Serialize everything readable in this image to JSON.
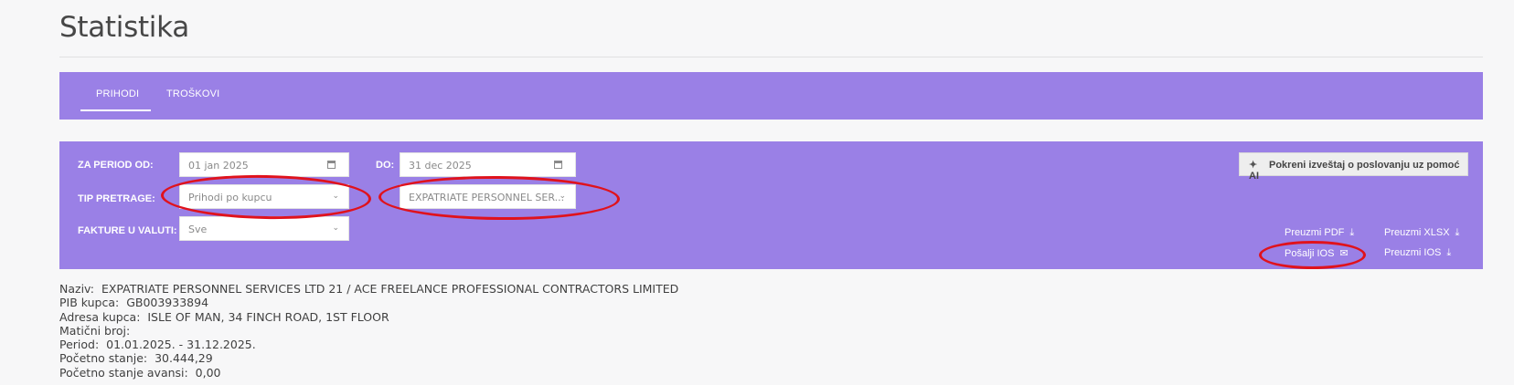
{
  "page": {
    "title": "Statistika"
  },
  "tabs": [
    {
      "label": "PRIHODI",
      "active": true
    },
    {
      "label": "TROŠKOVI",
      "active": false
    }
  ],
  "filters": {
    "period_from_label": "ZA PERIOD OD:",
    "period_from_value": "01 jan 2025",
    "period_to_label": "DO:",
    "period_to_value": "31 dec 2025",
    "search_type_label": "TIP PRETRAGE:",
    "search_type_value": "Prihodi po kupcu",
    "customer_value": "EXPATRIATE PERSONNEL SER...",
    "currency_label": "FAKTURE U VALUTI:",
    "currency_value": "Sve"
  },
  "actions": {
    "ai_report_label": "Pokreni izveštaj o poslovanju uz pomoć AI",
    "download_pdf_label": "Preuzmi PDF",
    "download_xlsx_label": "Preuzmi XLSX",
    "send_ios_label": "Pošalji IOS",
    "download_ios_label": "Preuzmi IOS"
  },
  "info": {
    "name_label": "Naziv:",
    "name_value": "EXPATRIATE PERSONNEL SERVICES LTD 21 / ACE FREELANCE PROFESSIONAL CONTRACTORS LIMITED",
    "pib_label": "PIB kupca:",
    "pib_value": "GB003933894",
    "address_label": "Adresa kupca:",
    "address_value": "ISLE OF MAN, 34 FINCH ROAD, 1ST FLOOR",
    "reg_label": "Matični broj:",
    "reg_value": "",
    "period_label": "Period:",
    "period_value": "01.01.2025. - 31.12.2025.",
    "opening_label": "Početno stanje:",
    "opening_value": "30.444,29",
    "opening_adv_label": "Početno stanje avansi:",
    "opening_adv_value": "0,00"
  },
  "colors": {
    "accent": "#9a80e6",
    "annotation": "#e0121c"
  }
}
